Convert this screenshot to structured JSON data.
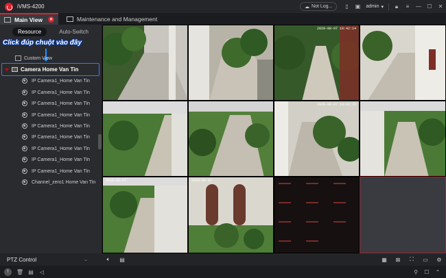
{
  "app": {
    "title": "iVMS-4200"
  },
  "titlebar": {
    "cloud_label": "Not Log...",
    "user": "admin"
  },
  "tabs": [
    {
      "label": "Main View"
    },
    {
      "label": "Maintenance and Management"
    }
  ],
  "left": {
    "subtabs": [
      {
        "label": "Resource"
      },
      {
        "label": "Auto-Switch"
      }
    ],
    "annotation": "Click đúp chuột vào đây",
    "custom_view": "Custom View",
    "group_name": "Camera Home Van Tin",
    "cameras": [
      "IP Camera1_Home Van Tin",
      "IP Camera1_Home Van Tin",
      "IP Camera1_Home Van Tin",
      "IP Camera1_Home Van Tin",
      "IP Camera1_Home Van Tin",
      "IP Camera1_Home Van Tin",
      "IP Camera1_Home Van Tin",
      "IP Camera1_Home Van Tin",
      "IP Camera1_Home Van Tin",
      "Channel_zero1 Home Van Tin"
    ]
  },
  "ptz": {
    "label": "PTZ Control"
  },
  "video_cells": [
    {
      "osd": ""
    },
    {
      "osd": ""
    },
    {
      "osd": "2020-08-07 18:42:14"
    },
    {
      "osd": ""
    },
    {
      "osd": ""
    },
    {
      "osd": ""
    },
    {
      "osd": "2020-08-07 18:42:15"
    },
    {
      "osd": ""
    },
    {
      "osd": "2020-08-07"
    },
    {
      "osd": "2020-08-07"
    },
    {
      "osd": ""
    },
    {
      "osd": ""
    }
  ]
}
